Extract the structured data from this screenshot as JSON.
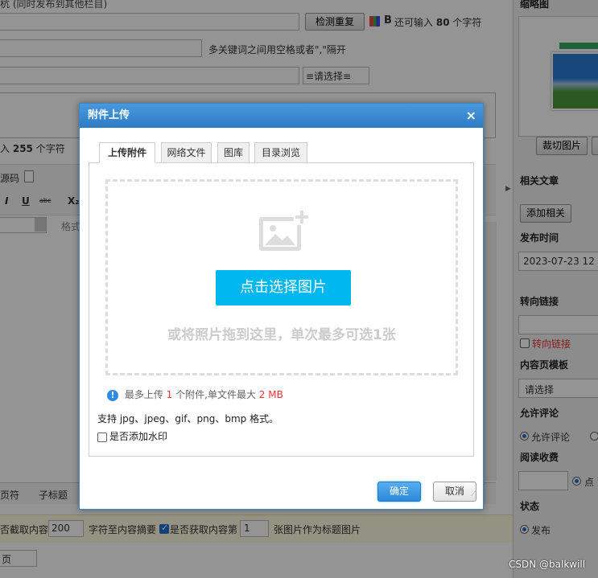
{
  "background": {
    "top_left_fragment": "杭 (同时发布到其他栏目)",
    "check_dup_button": "检测重复",
    "bold_icon_label": "B",
    "remaining_chars_label": "还可输入",
    "remaining_chars_count": "80",
    "remaining_chars_unit": "个字符",
    "keywords_hint": "多关键词之间用空格或者\",\"隔开",
    "select_placeholder": "≡请选择≡",
    "desc_remaining_prefix": "入",
    "desc_remaining_count": "255",
    "desc_remaining_unit": "个字符",
    "toolbar_source": "源码",
    "toolbar_format": "格式",
    "bottom_tabs": [
      "页符",
      "子标题"
    ],
    "bottom_bar": {
      "excerpt_label": "否截取内容",
      "excerpt_value": "200",
      "excerpt_suffix": "字符至内容摘要",
      "fetch_label": "是否获取内容第",
      "fetch_value": "1",
      "fetch_suffix": "张图片作为标题图片"
    },
    "page_select": "页"
  },
  "sidebar": {
    "thumbnail_label": "缩略图",
    "crop_button": "裁切图片",
    "related_label": "相关文章",
    "add_related_button": "添加相关",
    "publish_time_label": "发布时间",
    "publish_time_value": "2023-07-23 12",
    "redirect_label": "转向链接",
    "redirect_checkbox": "转向链接",
    "template_label": "内容页模板",
    "template_value": "请选择",
    "comment_label": "允许评论",
    "comment_option": "允许评论",
    "charge_label": "阅读收费",
    "charge_radio": "点",
    "status_label": "状态",
    "status_option": "发布"
  },
  "dialog": {
    "title": "附件上传",
    "close": "×",
    "tabs": [
      {
        "label": "上传附件"
      },
      {
        "label": "网络文件"
      },
      {
        "label": "图库"
      },
      {
        "label": "目录浏览"
      }
    ],
    "pick_button": "点击选择图片",
    "drop_tip": "或将照片拖到这里，单次最多可选1张",
    "info_prefix": "最多上传",
    "info_count": "1",
    "info_mid": "个附件,单文件最大",
    "info_size": "2 MB",
    "formats": "支持 jpg、jpeg、gif、png、bmp 格式。",
    "watermark_checkbox": "是否添加水印",
    "ok_button": "确定",
    "cancel_button": "取消"
  },
  "watermark": "CSDN @balkwill",
  "colors": {
    "dialog_title": "#2d7cc4",
    "pick_button": "#00b7ee",
    "highlight_red": "#e33333"
  }
}
